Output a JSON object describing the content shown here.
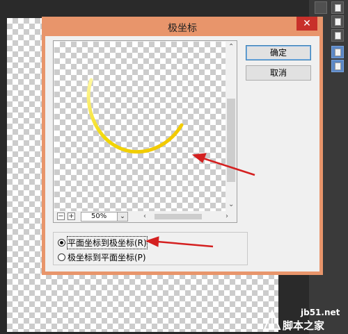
{
  "dialog": {
    "title": "极坐标",
    "close_glyph": "✕",
    "ok_label": "确定",
    "cancel_label": "取消"
  },
  "preview": {
    "zoom_value": "50%",
    "zoom_out_glyph": "−",
    "zoom_in_glyph": "+",
    "dropdown_glyph": "⌄",
    "stroke_color_light": "#fff8a0",
    "stroke_color": "#f2d800"
  },
  "options": {
    "rect_to_polar": "平面坐标到极坐标(R)",
    "polar_to_rect": "极坐标到平面坐标(P)",
    "selected": "rect_to_polar"
  },
  "annotations": {
    "arrow_color": "#d42020"
  },
  "watermark": {
    "site": "jb51.net",
    "logo_text": "脚本之家"
  },
  "icons": [
    "close-icon",
    "zoom-out-icon",
    "zoom-in-icon",
    "chevron-down-icon",
    "document-icon",
    "arrow-up-icon",
    "arrow-down-icon",
    "arrow-left-icon",
    "arrow-right-icon"
  ]
}
